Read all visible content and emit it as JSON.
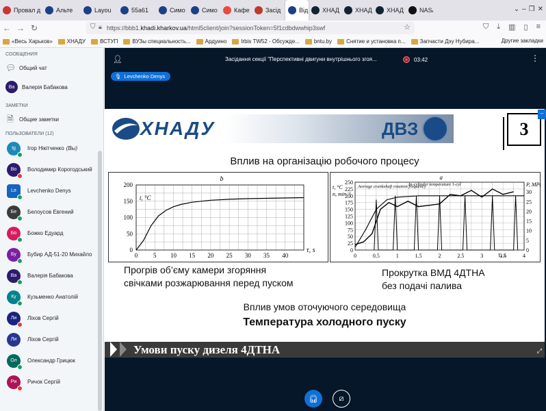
{
  "browser": {
    "tabs": [
      {
        "label": "Провал д",
        "color": "#c33"
      },
      {
        "label": "Альте",
        "color": "#1d3f8a"
      },
      {
        "label": "Layou",
        "color": "#1d3f8a"
      },
      {
        "label": "55a61",
        "color": "#1d3f8a"
      },
      {
        "label": "Симо",
        "color": "#1d3f8a"
      },
      {
        "label": "Симо",
        "color": "#1d3f8a"
      },
      {
        "label": "Кафе",
        "color": "#e74c3c"
      },
      {
        "label": "Засід",
        "color": "#c0392b"
      },
      {
        "label": "Від",
        "color": "#1d3f8a",
        "active": true
      },
      {
        "label": "ХНАД",
        "color": "#123"
      },
      {
        "label": "ХНАД",
        "color": "#123"
      },
      {
        "label": "ХНАД",
        "color": "#123"
      },
      {
        "label": "NASA",
        "color": "#111"
      }
    ],
    "url_prefix": "https://bbb1.",
    "url_host": "khadi.kharkov.ua",
    "url_path": "/html5client/join?sessionToken=5f1cdbdwwhip3swf",
    "bookmarks": [
      "«Весь Харьков»",
      "ХНАДУ",
      "ВСТУП",
      "ВУЗы специальность...",
      "Ардуино",
      "Irbis TW52 - Обсужде...",
      "bntu.by",
      "Снятие и установка п...",
      "Запчасти Дэу Нубира..."
    ],
    "bookmarks_right": "Другие закладки"
  },
  "sidebar": {
    "messages_title": "СООБЩЕНИЯ",
    "public_chat": "Общий чат",
    "chat_user": {
      "initials": "Ва",
      "name": "Валерія Бабакова"
    },
    "notes_title": "ЗАМЕТКИ",
    "shared_notes": "Общие заметки",
    "users_title": "ПОЛЬЗОВАТЕЛИ (12)",
    "users": [
      {
        "initials": "Ig",
        "name": "Ігор Нікітченко",
        "suffix": "(Вы)",
        "color": "#1b8ab8",
        "badge": "#1b9e5e"
      },
      {
        "initials": "Во",
        "name": "Володимир Корогодський",
        "color": "#2d1b6e",
        "badge": "#e23c3c"
      },
      {
        "initials": "Le",
        "name": "Levchenko Denys",
        "color": "#1565c0",
        "badge": "#1b9e5e",
        "presenter": true
      },
      {
        "initials": "Бе",
        "name": "Белоусов Евгений",
        "color": "#3b3b3b",
        "badge": "#1b9e5e"
      },
      {
        "initials": "Бо",
        "name": "Божко Едуард",
        "color": "#d81b60",
        "badge": "#1b9e5e"
      },
      {
        "initials": "Бу",
        "name": "Бубир АД-51-20 Михайло",
        "color": "#7b1fa2",
        "badge": "#1b9e5e"
      },
      {
        "initials": "Ва",
        "name": "Валерія Бабакова",
        "color": "#2d1b6e",
        "badge": "#1b9e5e"
      },
      {
        "initials": "Ку",
        "name": "Кузьменко Анатолій",
        "color": "#00838f",
        "badge": "#1b9e5e"
      },
      {
        "initials": "Ли",
        "name": "Ліхов Сергій",
        "color": "#1a237e",
        "badge": "#e23c3c"
      },
      {
        "initials": "Ли",
        "name": "Ліхов Сергій",
        "color": "#283593",
        "badge": ""
      },
      {
        "initials": "Ол",
        "name": "Олександр Грицюк",
        "color": "#00695c",
        "badge": "#1b9e5e"
      },
      {
        "initials": "Ри",
        "name": "Ричок Сергій",
        "color": "#ad1457",
        "badge": "#e23c3c"
      }
    ]
  },
  "main": {
    "meeting_title": "Засідання секції \"Перспективні двигуни внутрішнього згоя...",
    "rec_time": "03:42",
    "talker": "Levchenko Denys"
  },
  "slide": {
    "logo_left": "ХНАДУ",
    "logo_right": "ДВЗ",
    "number": "3",
    "title": "Вплив на організацію робочого процесу",
    "caption_left": [
      "Прогрів об’єму камери згоряння",
      "свічками розжарювання перед пуском"
    ],
    "caption_right": [
      "Прокрутка ВМД 4ДТНА",
      "без подачі палива"
    ],
    "sub1": "Вплив умов оточуючого середовища",
    "sub2": "Температура холодного пуску",
    "footer": "Умови пуску дизеля 4ДТНА"
  },
  "chart_data": [
    {
      "type": "line",
      "panel": "b",
      "ylabel": "t, °C",
      "xlabel": "τ, s",
      "x": [
        0,
        2,
        4,
        6,
        8,
        10,
        12,
        15,
        20,
        25,
        30,
        35,
        40,
        45
      ],
      "y": [
        0,
        30,
        75,
        105,
        122,
        133,
        140,
        147,
        153,
        156,
        158,
        159,
        160,
        161
      ],
      "xlim": [
        0,
        45
      ],
      "ylim": [
        0,
        200
      ],
      "xticks": [
        0,
        5,
        10,
        15,
        20,
        25,
        30,
        35,
        40
      ],
      "yticks": [
        0,
        50,
        100,
        150,
        200
      ],
      "grid": true
    },
    {
      "type": "line",
      "panel": "a",
      "ylabel_left": "t, °C\nn, min⁻¹",
      "ylabel_right": "P, MPa",
      "xlabel": "τ, s",
      "xlim": [
        0,
        4
      ],
      "ylim": [
        0,
        250
      ],
      "ylim_right": [
        0,
        35
      ],
      "xticks": [
        0,
        0.5,
        1,
        1.5,
        2,
        2.5,
        3,
        3.5,
        4
      ],
      "yticks": [
        0,
        25,
        50,
        75,
        100,
        125,
        150,
        175,
        200,
        225,
        250
      ],
      "yticks_right": [
        0,
        5,
        10,
        15,
        20,
        25,
        30
      ],
      "annotations": [
        "Average crankshaft rotation frequency",
        "In-cylinder temperature 1-cyl"
      ],
      "series": [
        {
          "name": "Average crankshaft rotation frequency",
          "x": [
            0,
            0.25,
            0.5,
            0.75,
            1.0,
            1.5,
            2.0,
            2.5,
            3.0,
            3.5,
            4.0
          ],
          "y": [
            10,
            75,
            150,
            185,
            195,
            200,
            200,
            200,
            200,
            200,
            200
          ]
        },
        {
          "name": "In-cylinder temperature 1-cyl",
          "x": [
            0,
            0.2,
            0.4,
            0.6,
            0.8,
            1.0,
            1.25,
            1.5,
            1.75,
            2.0,
            2.25,
            2.5,
            2.75,
            3.0,
            3.25,
            3.5,
            3.75
          ],
          "y": [
            20,
            30,
            60,
            150,
            175,
            160,
            180,
            160,
            165,
            170,
            205,
            200,
            220,
            195,
            225,
            205,
            215
          ]
        },
        {
          "name": "P",
          "x": [
            0.45,
            0.5,
            0.55,
            0.9,
            0.95,
            1.0,
            1.4,
            1.45,
            1.5,
            1.95,
            2.0,
            2.05,
            2.55,
            2.6,
            2.65,
            3.2,
            3.25,
            3.3,
            3.75,
            3.8,
            3.85
          ],
          "y": [
            0,
            26,
            0,
            0,
            28,
            0,
            0,
            28,
            0,
            0,
            28,
            0,
            0,
            28,
            0,
            0,
            28,
            0,
            0,
            28,
            0
          ]
        }
      ]
    }
  ]
}
